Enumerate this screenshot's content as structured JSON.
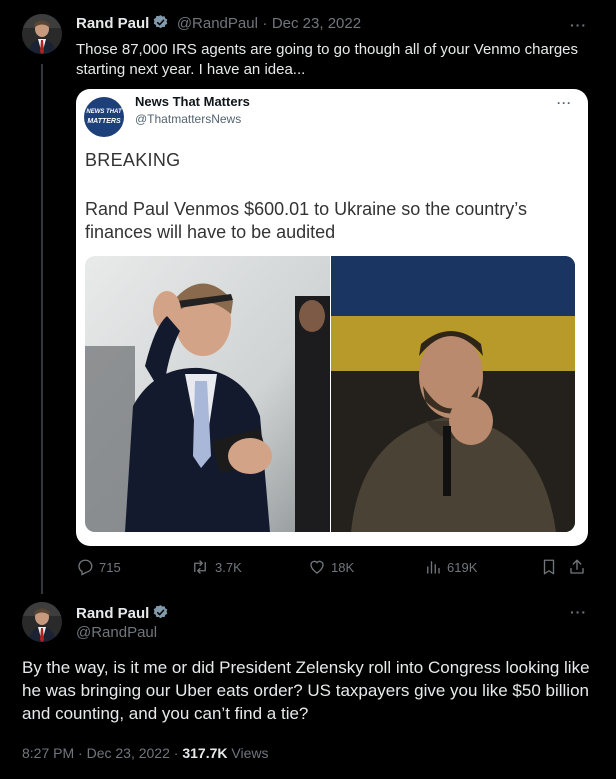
{
  "tweet1": {
    "name": "Rand Paul",
    "handle": "@RandPaul",
    "separator": "·",
    "date": "Dec 23, 2022",
    "text": "Those 87,000 IRS agents are going to go though all of your Venmo charges starting next year. I have an idea...",
    "more": "···",
    "media": {
      "avatar_top": "NEWS THAT",
      "avatar_bottom": "MATTERS",
      "name": "News That Matters",
      "handle": "@ThatmattersNews",
      "more": "···",
      "breaking": "BREAKING",
      "headline": "Rand Paul Venmos $600.01 to Ukraine so the country’s finances will have to be audited"
    },
    "actions": {
      "replies": "715",
      "reposts": "3.7K",
      "likes": "18K",
      "views": "619K"
    }
  },
  "tweet2": {
    "name": "Rand Paul",
    "handle": "@RandPaul",
    "more": "···",
    "text": "By the way, is it me or did President Zelensky roll into Congress looking like he was bringing our Uber eats order? US taxpayers give you like $50 billion and counting, and you can’t find a tie?",
    "time": "8:27 PM",
    "separator": "·",
    "date": "Dec 23, 2022",
    "separator2": "·",
    "views_count": "317.7K",
    "views_label": "Views"
  },
  "colors": {
    "background": "#000000",
    "text": "#e7e9ea",
    "muted": "#71767b",
    "verified": "#829aab",
    "card_bg": "#ffffff"
  },
  "icons": [
    "verified-badge-icon",
    "more-icon",
    "reply-icon",
    "repost-icon",
    "like-icon",
    "views-icon",
    "bookmark-icon",
    "share-icon"
  ]
}
